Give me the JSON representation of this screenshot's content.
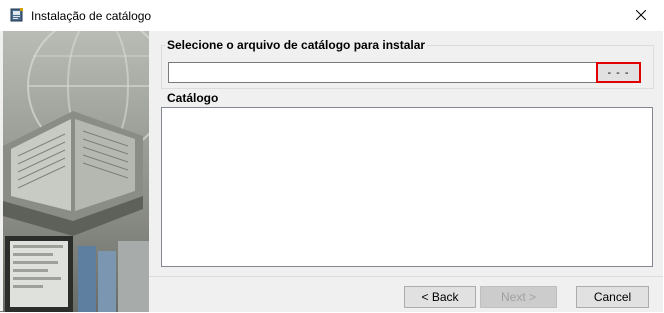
{
  "window": {
    "title": "Instalação de catálogo",
    "icon": "catalog-app-icon",
    "close_icon": "close-icon"
  },
  "file_group": {
    "label": "Selecione o arquivo de catálogo para instalar",
    "file_value": "",
    "browse_label": "- - -"
  },
  "catalog_group": {
    "label": "Catálogo",
    "items": []
  },
  "buttons": {
    "back": "< Back",
    "next": "Next >",
    "cancel": "Cancel"
  },
  "colors": {
    "highlight": "#e00000"
  }
}
